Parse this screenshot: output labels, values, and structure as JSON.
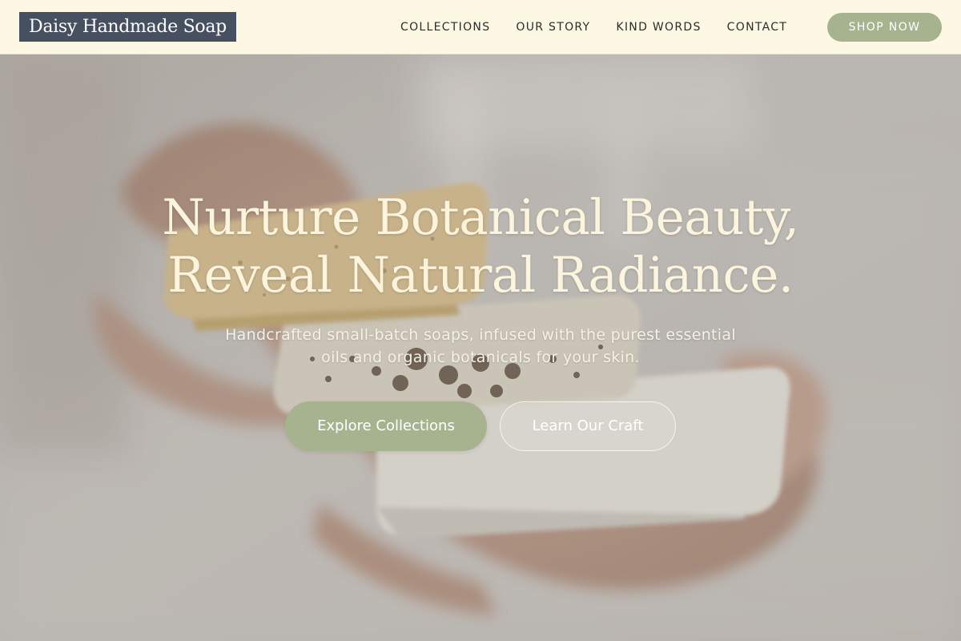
{
  "header": {
    "logo": "Daisy Handmade Soap",
    "nav": [
      {
        "label": "COLLECTIONS"
      },
      {
        "label": "OUR STORY"
      },
      {
        "label": "KIND WORDS"
      },
      {
        "label": "CONTACT"
      }
    ],
    "shop_button": "SHOP NOW"
  },
  "hero": {
    "title_line1": "Nurture Botanical Beauty,",
    "title_line2": "Reveal Natural Radiance.",
    "subtitle_line1": "Handcrafted small-batch soaps, infused with the purest essential",
    "subtitle_line2": "oils and organic botanicals for your skin.",
    "primary_button": "Explore Collections",
    "secondary_button": "Learn Our Craft"
  },
  "colors": {
    "header_bg": "#fcf8e3",
    "logo_bg": "#475061",
    "accent_sage": "#a6b38e",
    "hero_title": "#fcf4dc"
  }
}
